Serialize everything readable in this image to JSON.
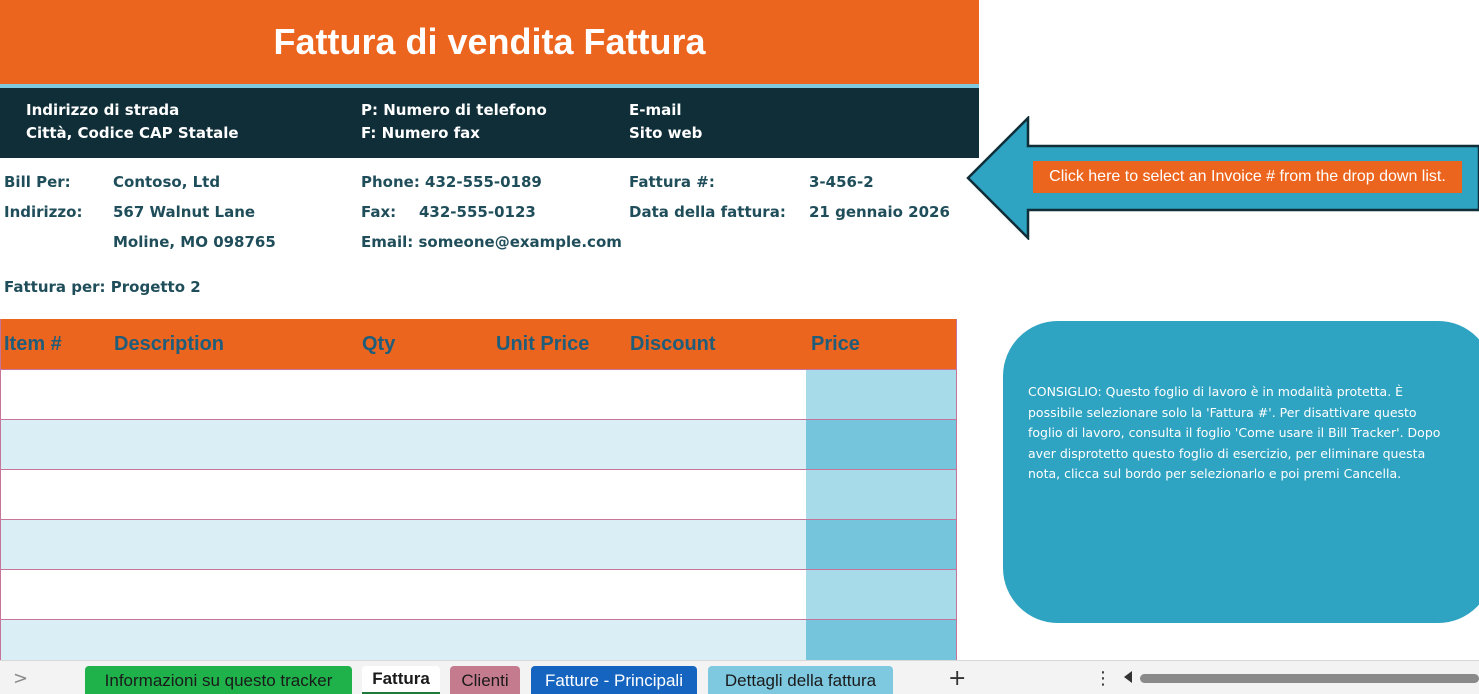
{
  "title": "Fattura di vendita Fattura",
  "company": {
    "street": "Indirizzo di strada",
    "city_line": "Città, Codice CAP Statale",
    "phone": "P: Numero di telefono",
    "fax": "F: Numero fax",
    "email": "E-mail",
    "website": "Sito web"
  },
  "bill": {
    "bill_to_label": "Bill Per:",
    "bill_to_value": "Contoso, Ltd",
    "address_label": "Indirizzo:",
    "address_line1": "567 Walnut Lane",
    "address_line2": "Moline, MO 098765",
    "phone_text": "Phone: 432-555-0189",
    "fax_label": "Fax:",
    "fax_value": "432-555-0123",
    "email_text": "Email: someone@example.com",
    "invoice_no_label": "Fattura #:",
    "invoice_no_value": "3-456-2",
    "date_label": "Data della fattura:",
    "date_value": "21 gennaio 2026",
    "invoice_for": "Fattura per: Progetto 2"
  },
  "table": {
    "headers": [
      "Item #",
      "Description",
      "Qty",
      "Unit Price",
      "Discount",
      "Price"
    ]
  },
  "callout": {
    "label": "Click here to select an Invoice # from the drop down list."
  },
  "tip": {
    "text": "CONSIGLIO: Questo foglio di lavoro è in modalità protetta. È possibile selezionare solo la 'Fattura #'. Per disattivare questo foglio di lavoro, consulta il foglio 'Come usare il Bill Tracker'. Dopo aver disprotetto questo foglio di esercizio, per eliminare questa nota, clicca sul bordo per selezionarlo e poi premi Cancella."
  },
  "sheet_tabs": {
    "tabs": [
      {
        "label": "Informazioni su questo tracker",
        "color": "#1fb14a"
      },
      {
        "label": "Fattura",
        "color": "#f3f3f3",
        "active": true
      },
      {
        "label": "Clienti",
        "color": "#c57b8e"
      },
      {
        "label": "Fatture - Principali",
        "color": "#1565c0"
      },
      {
        "label": "Dettagli della fattura",
        "color": "#7ec8e0"
      }
    ],
    "add_symbol": "+",
    "more_symbol": "⋮",
    "prev_symbol": ">"
  },
  "colors": {
    "accent_orange": "#ec651e",
    "dark_band": "#0f2e38",
    "tip_blue": "#2fa3c2",
    "text_teal": "#1f4e5a"
  }
}
